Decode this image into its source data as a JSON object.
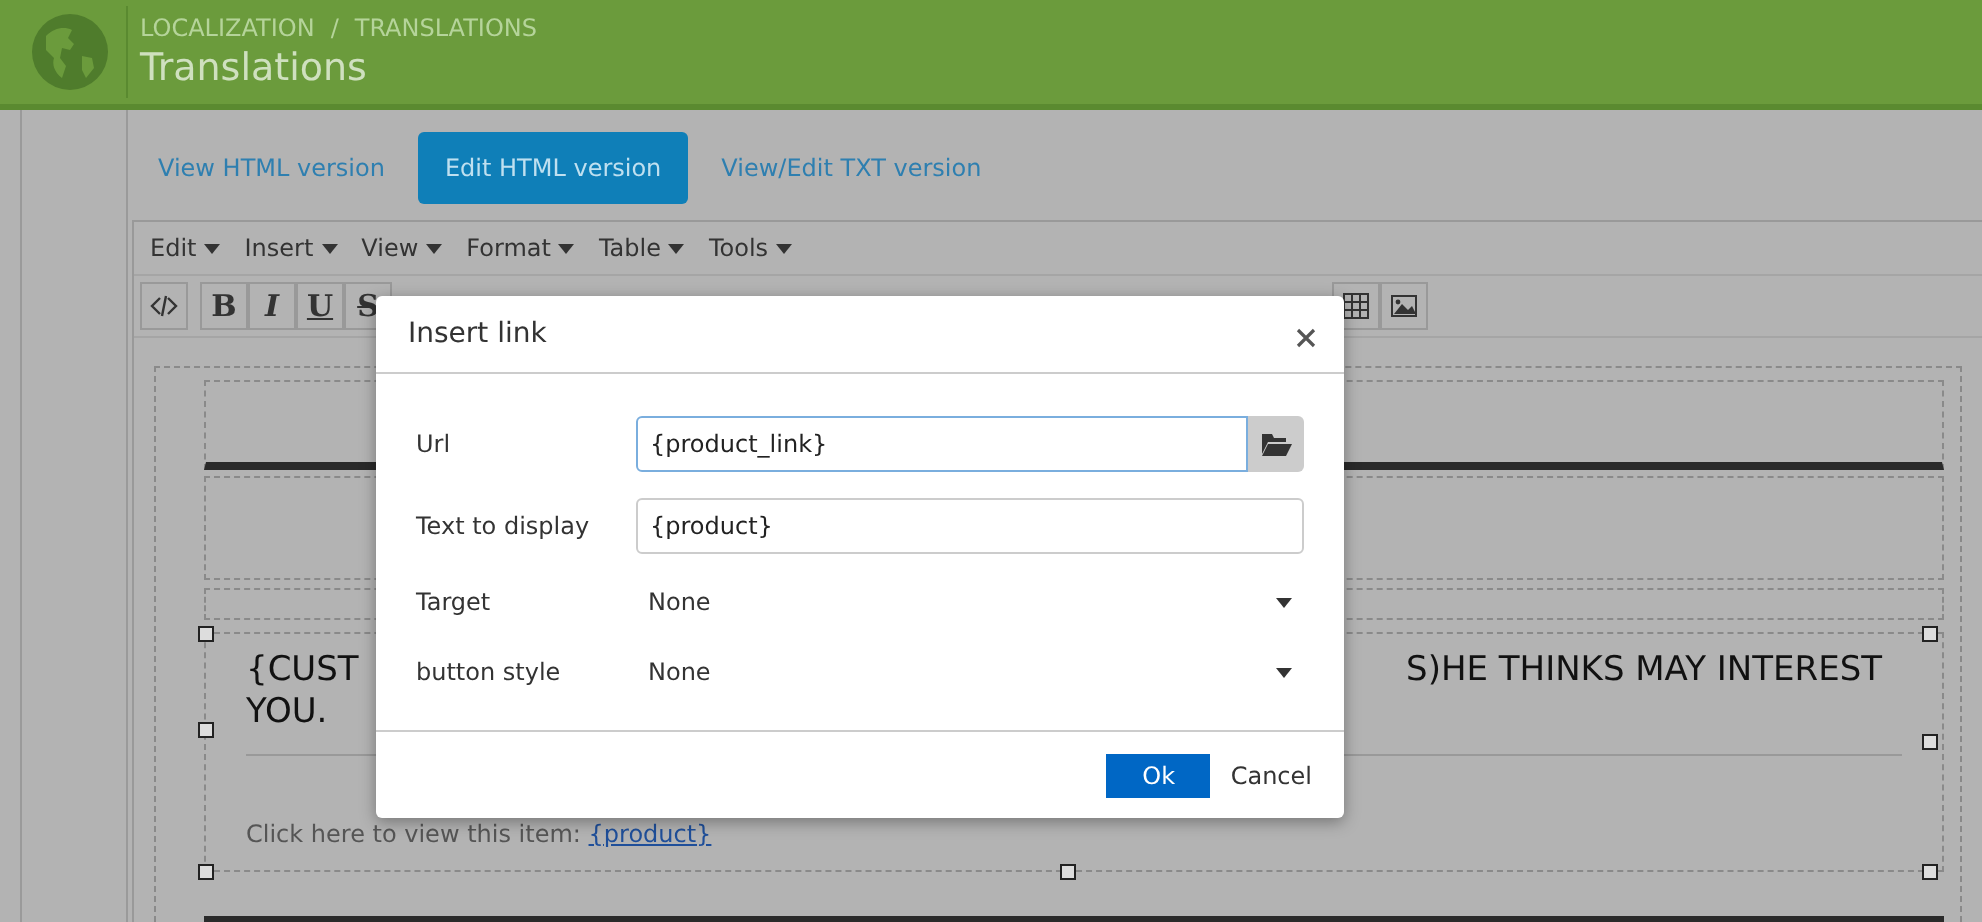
{
  "header": {
    "breadcrumbs": [
      "LOCALIZATION",
      "/",
      "TRANSLATIONS"
    ],
    "title": "Translations"
  },
  "tabs": [
    {
      "label": "View HTML version",
      "selected": false
    },
    {
      "label": "Edit HTML version",
      "selected": true
    },
    {
      "label": "View/Edit TXT version",
      "selected": false
    }
  ],
  "editor": {
    "menu": [
      "Edit",
      "Insert",
      "View",
      "Format",
      "Table",
      "Tools"
    ],
    "toolbar": [
      {
        "kind": "code"
      },
      {
        "kind": "bold",
        "label": "B"
      },
      {
        "kind": "italic",
        "label": "I"
      },
      {
        "kind": "underline",
        "label": "U"
      },
      {
        "kind": "strike",
        "label": "S"
      },
      {
        "kind": "table"
      },
      {
        "kind": "image"
      }
    ],
    "content": {
      "heading_parts": [
        "{CUST",
        "S)HE THINKS MAY INTEREST",
        "YOU."
      ],
      "body": "Click here to view this item:",
      "link": "{product}"
    }
  },
  "dialog": {
    "title": "Insert link",
    "fields": [
      {
        "label": "Url",
        "kind": "text",
        "value": "{product_link}",
        "focused": true,
        "browse": true
      },
      {
        "label": "Text to display",
        "kind": "text",
        "value": "{product}",
        "focused": false,
        "browse": false
      },
      {
        "label": "Target",
        "kind": "select",
        "value": "None"
      },
      {
        "label": "button style",
        "kind": "select",
        "value": "None"
      }
    ],
    "buttons": [
      {
        "label": "Ok",
        "kind": "primary"
      },
      {
        "label": "Cancel",
        "kind": "plain"
      }
    ]
  }
}
